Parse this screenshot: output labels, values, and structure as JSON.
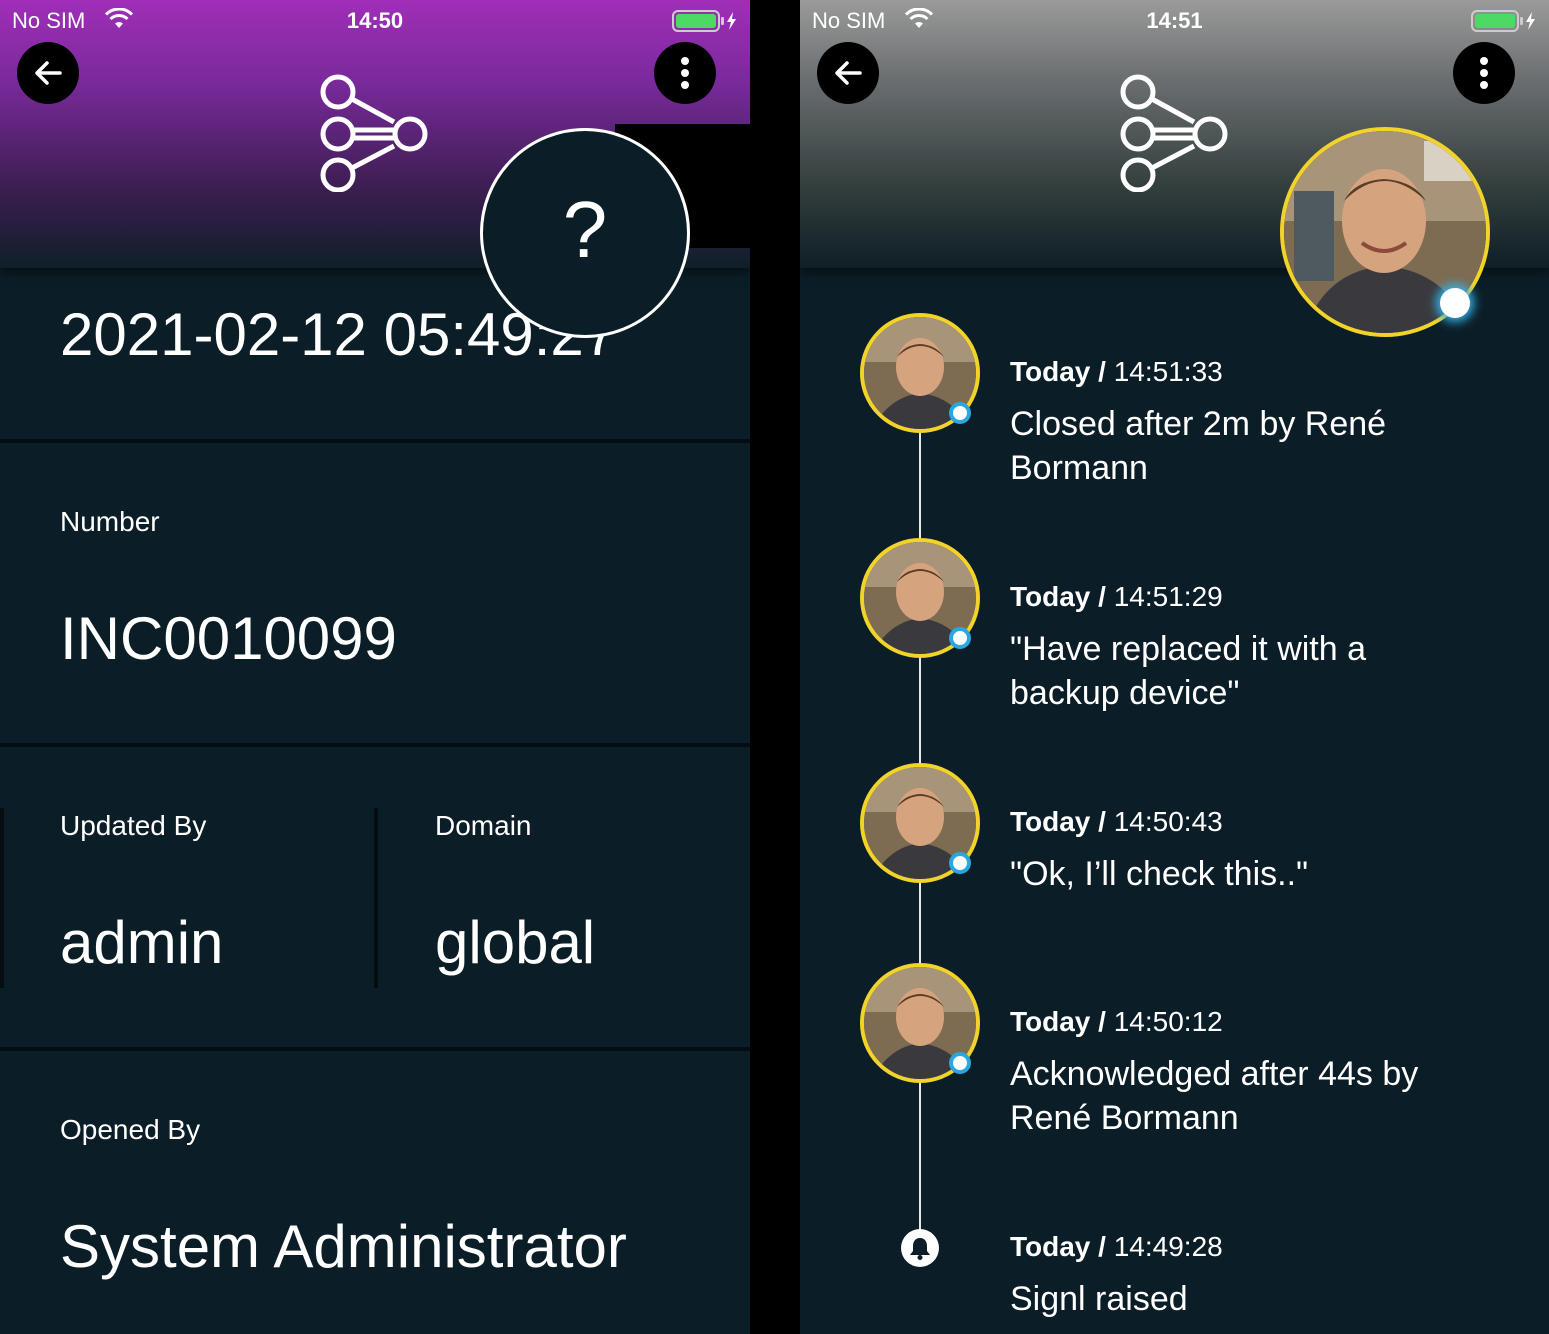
{
  "left": {
    "status": {
      "carrier": "No SIM",
      "time": "14:50"
    },
    "datetime": "2021-02-12 05:49:27",
    "help_symbol": "?",
    "number": {
      "label": "Number",
      "value": "INC0010099"
    },
    "updated_by": {
      "label": "Updated By",
      "value": "admin"
    },
    "domain": {
      "label": "Domain",
      "value": "global"
    },
    "opened_by": {
      "label": "Opened By",
      "value": "System Administrator"
    }
  },
  "right": {
    "status": {
      "carrier": "No SIM",
      "time": "14:51"
    },
    "timeline": [
      {
        "day": "Today",
        "sep": " / ",
        "time": "14:51:33",
        "text": "Closed after 2m by René Bormann"
      },
      {
        "day": "Today",
        "sep": " / ",
        "time": "14:51:29",
        "text": "\"Have replaced it with a backup device\""
      },
      {
        "day": "Today",
        "sep": " / ",
        "time": "14:50:43",
        "text": "\"Ok, I’ll check this..\""
      },
      {
        "day": "Today",
        "sep": " / ",
        "time": "14:50:12",
        "text": "Acknowledged after 44s by René Bormann"
      },
      {
        "day": "Today",
        "sep": " / ",
        "time": "14:49:28",
        "text": "Signl raised"
      }
    ]
  },
  "colors": {
    "left_header_accent": "#a02eb8",
    "background": "#0b1e27",
    "avatar_ring": "#f1d32a",
    "presence": "#2aa6e0",
    "battery": "#4cd964"
  },
  "icons": [
    "wifi-icon",
    "battery-icon",
    "charging-icon",
    "back-arrow-icon",
    "more-vertical-icon",
    "signl-logo-icon",
    "bell-icon"
  ]
}
